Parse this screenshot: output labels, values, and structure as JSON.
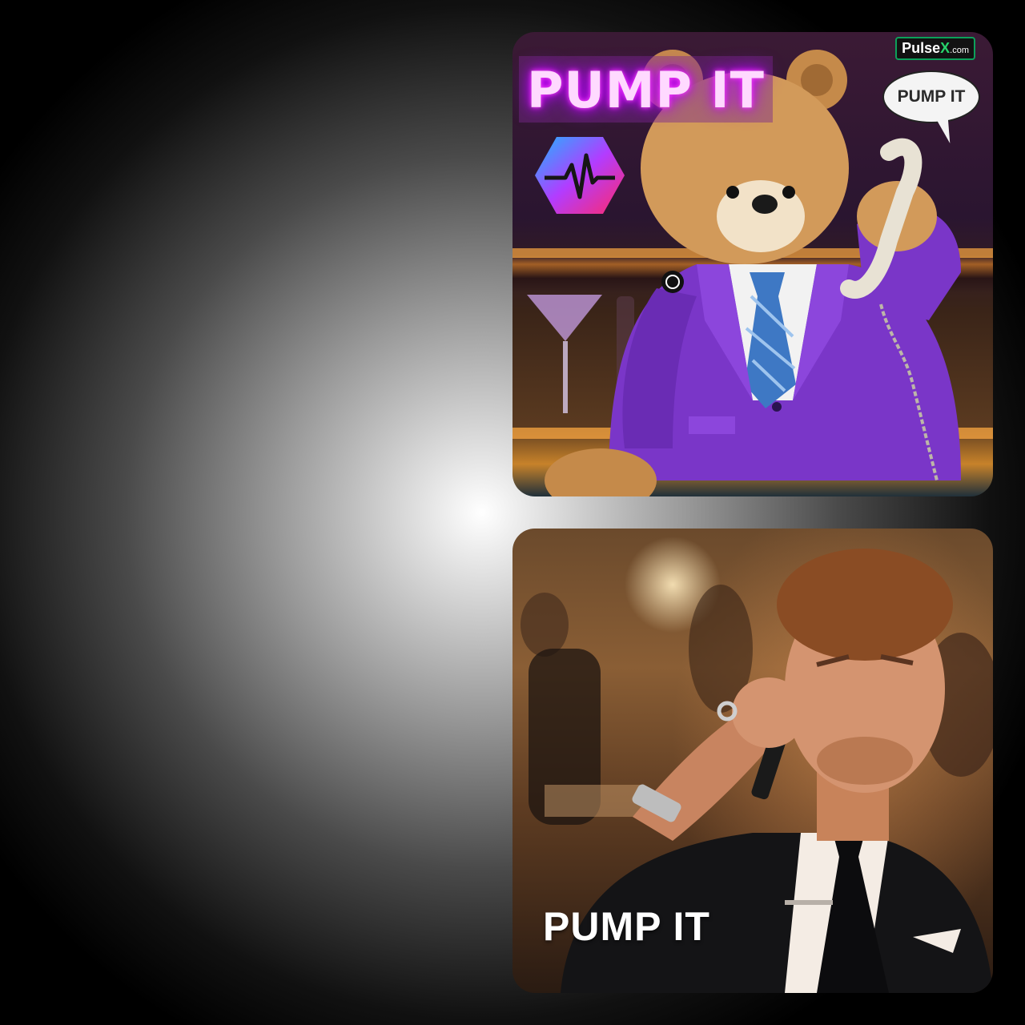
{
  "top_panel": {
    "neon_sign": "PUMP IT",
    "brand_badge": {
      "name": "Pulse",
      "x": "X",
      "suffix": ".com"
    },
    "speech_bubble": "PUMP IT",
    "logo_icon": "pulse-hexagon-icon",
    "lapel_pin_icon": "pin-icon"
  },
  "bottom_panel": {
    "caption": "PUMP IT"
  },
  "colors": {
    "neon_pink": "#ff4cff",
    "suit_purple": "#7a36c8",
    "badge_green": "#0ca05a"
  }
}
